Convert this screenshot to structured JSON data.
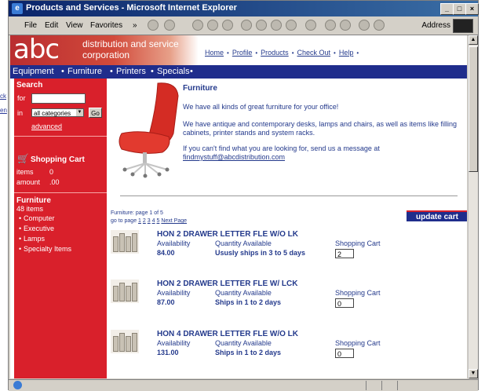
{
  "window": {
    "title": "Products and Services - Microsoft Internet Explorer",
    "controls": {
      "minimize": "_",
      "maximize": "□",
      "close": "×"
    }
  },
  "menu": [
    "File",
    "Edit",
    "View",
    "Favorites"
  ],
  "toolbar": {
    "chevron": "»",
    "address_label": "Address"
  },
  "background_links": [
    "ck",
    "en"
  ],
  "site": {
    "logo_abc": "abc",
    "logo_line1": "distribution and service",
    "logo_line2": "corporation",
    "top_links": [
      "Home",
      "Profile",
      "Products",
      "Check Out",
      "Help"
    ],
    "nav_items": [
      "Equipment",
      "Furniture",
      "Printers",
      "Specials"
    ],
    "nav_bullet": "•"
  },
  "sidebar": {
    "search_heading": "Search",
    "for_label": "for",
    "in_label": "in",
    "category_value": "all categories",
    "go_label": "Go",
    "advanced_link": "advanced",
    "cart_heading": "Shopping Cart",
    "items_label": "items",
    "items_value": "0",
    "amount_label": "amount",
    "amount_value": ".00",
    "category_heading": "Furniture",
    "category_count": "48 items",
    "subcategories": [
      "Computer",
      "Executive",
      "Lamps",
      "Specialty Items"
    ]
  },
  "main": {
    "category_title": "Furniture",
    "intro": "We have all kinds of great furniture for your office!",
    "desc": "We have antique and contemporary desks, lamps and chairs, as well as items like filling cabinets, printer stands and system racks.",
    "contact": "If you can't find what you are looking for, send us a message at",
    "email": "findmystuff@abcdistribution.com",
    "page_info": "Furniture: page 1 of 5",
    "goto_label": "go to page",
    "pages": [
      "1",
      "2",
      "3",
      "4",
      "5"
    ],
    "next_link": "Next Page",
    "update_cart": "update cart",
    "labels": {
      "availability": "Availability",
      "quantity": "Quantity Available",
      "cart": "Shopping Cart"
    },
    "products": [
      {
        "name": "HON 2 DRAWER LETTER FLE W/O LK",
        "availability": "84.00",
        "quantity": "Ususly ships in 3 to 5 days",
        "cart_qty": "2"
      },
      {
        "name": "HON 2 DRAWER LETTER FLE W/ LCK",
        "availability": "87.00",
        "quantity": "Ships in 1 to 2 days",
        "cart_qty": "0"
      },
      {
        "name": "HON 4 DRAWER LETTER FLE W/O LK",
        "availability": "131.00",
        "quantity": "Ships in 1 to 2 days",
        "cart_qty": "0"
      }
    ]
  }
}
